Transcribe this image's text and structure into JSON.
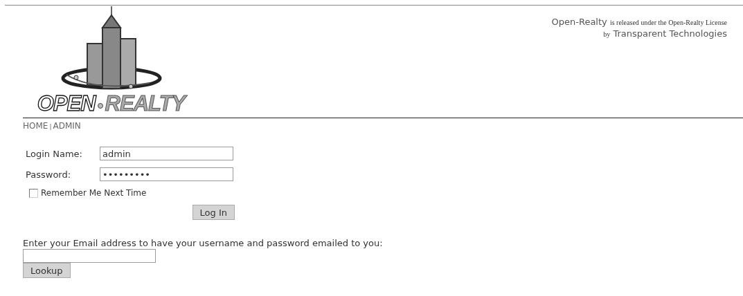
{
  "logo": {
    "word_1": "OPEN",
    "word_2": "REALTY"
  },
  "license": {
    "product": "Open-Realty",
    "notice": "is released under the Open-Realty License",
    "by": "by",
    "company": "Transparent Technologies"
  },
  "nav": {
    "links": [
      {
        "label": "HOME"
      },
      {
        "label": "ADMIN"
      }
    ],
    "separator": "|"
  },
  "login": {
    "fields": [
      {
        "label": "Login Name:",
        "value": "admin"
      },
      {
        "label": "Password:",
        "value": "•••••••••"
      }
    ],
    "remember": {
      "label": "Remember Me Next Time",
      "checked": false
    },
    "submit": "Log In"
  },
  "lookup": {
    "prompt": "Enter your Email address to have your username and password emailed to you:",
    "button": "Lookup"
  }
}
